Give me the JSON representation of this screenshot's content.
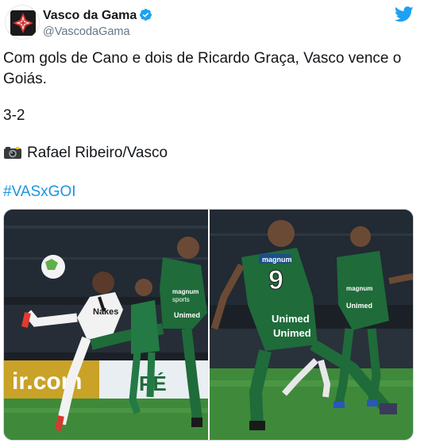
{
  "author": {
    "display_name": "Vasco da Gama",
    "handle": "@VascodaGama",
    "verified": true,
    "avatar_icon": "vasco-cross-crest-icon"
  },
  "platform_icon": "twitter-bird-icon",
  "tweet": {
    "line1": "Com gols de Cano e dois de Ricardo Graça, Vasco vence o",
    "line2": "Goiás.",
    "score": "3-2",
    "photo_credit": "Rafael Ribeiro/Vasco",
    "photo_credit_icon": "camera-icon",
    "hashtag": "#VASxGOI"
  },
  "media": {
    "photos": [
      {
        "description_icon": "football-match-photo-left",
        "visible_text": [
          "Unimed",
          "magnum sports",
          "PÉ",
          "Nakes",
          "ir.com"
        ]
      },
      {
        "description_icon": "football-match-photo-right",
        "visible_text": [
          "9",
          "Unimed",
          "Unimed",
          "magnum"
        ]
      }
    ]
  },
  "colors": {
    "link_blue": "#1b95e0",
    "twitter_blue": "#1da1f2",
    "secondary_text": "#657786",
    "goias_green": "#1f6b3a",
    "vasco_white": "#f5f5f5",
    "pitch_green": "#3f8a3a"
  }
}
